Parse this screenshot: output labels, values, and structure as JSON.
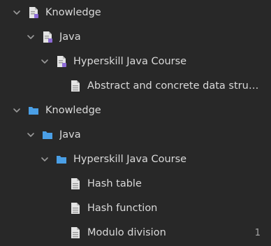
{
  "tree": {
    "rows": [
      {
        "label": "Knowledge",
        "icon": "note-folder-icon",
        "expanded": true
      },
      {
        "label": "Java",
        "icon": "note-folder-icon",
        "expanded": true
      },
      {
        "label": "Hyperskill Java Course",
        "icon": "note-folder-icon",
        "expanded": true
      },
      {
        "label": "Abstract and concrete data struct…",
        "icon": "document-icon"
      },
      {
        "label": "Knowledge",
        "icon": "folder-icon",
        "expanded": true
      },
      {
        "label": "Java",
        "icon": "folder-icon",
        "expanded": true
      },
      {
        "label": "Hyperskill Java Course",
        "icon": "folder-icon",
        "expanded": true
      },
      {
        "label": "Hash table",
        "icon": "document-icon"
      },
      {
        "label": "Hash function",
        "icon": "document-icon"
      },
      {
        "label": "Modulo division",
        "icon": "document-icon",
        "count": "1"
      }
    ]
  },
  "colors": {
    "background": "#282828",
    "text": "#dadada",
    "folder_blue": "#4a9fe6",
    "note_purple": "#8d6bd6"
  }
}
